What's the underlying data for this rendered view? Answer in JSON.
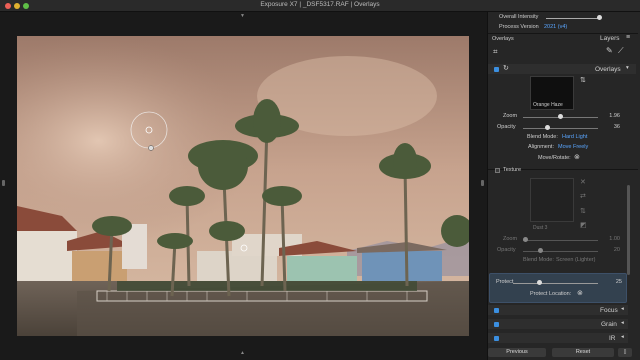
{
  "window": {
    "title": "Exposure X7 | _DSF5317.RAF | Overlays"
  },
  "panel": {
    "overall_intensity_label": "Overall Intensity",
    "overall_intensity_value": 1.0,
    "process_version_label": "Process Version",
    "process_version_value": "2021 (v4)",
    "overlays_label": "Overlays",
    "layers_label": "Layers",
    "overlays_section_title": "Overlays",
    "overlay_thumb_label": "Orange Haze",
    "zoom_label": "Zoom",
    "zoom_value": "1.96",
    "opacity_label": "Opacity",
    "opacity_value": "36",
    "blend_mode_label": "Blend Mode:",
    "blend_mode_value": "Hard Light",
    "alignment_label": "Alignment:",
    "alignment_value": "Move Freely",
    "move_rotate_label": "Move/Rotate:",
    "texture_label": "Texture",
    "texture_thumb_label": "Dust 3",
    "texture_zoom_label": "Zoom",
    "texture_zoom_value": "1.00",
    "texture_opacity_label": "Opacity",
    "texture_opacity_value": "20",
    "texture_blend_mode_label": "Blend Mode:",
    "texture_blend_mode_value": "Screen (Lighter)",
    "protect_label": "Protect",
    "protect_value": "25",
    "protect_location_label": "Protect Location:",
    "focus_label": "Focus",
    "grain_label": "Grain",
    "ir_label": "IR",
    "previous_button": "Previous",
    "reset_button": "Reset"
  },
  "colors": {
    "accent_blue": "#3b8fe0",
    "link_blue": "#5aa6ff",
    "panel_bg": "#262626",
    "protect_highlight": "#33414f"
  }
}
